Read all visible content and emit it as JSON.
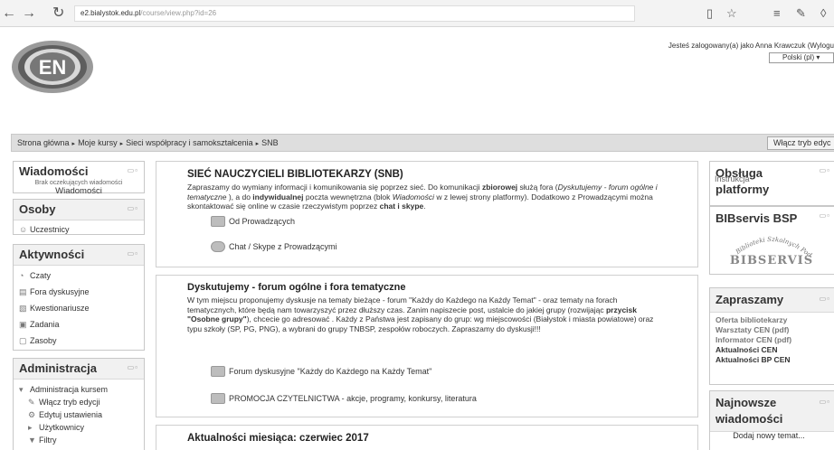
{
  "browser": {
    "url_host": "e2.bialystok.edu.pl",
    "url_path": "/course/view.php?id=26",
    "back_icon": "back-arrow-icon",
    "forward_icon": "forward-arrow-icon",
    "refresh_icon": "refresh-icon"
  },
  "header": {
    "login_info": "Jesteś zalogowany(a) jako Anna Krawczuk (Wylogu",
    "language": "Polski (pl)",
    "logo_letters": "EN"
  },
  "breadcrumb": {
    "items": [
      "Strona główna",
      "Moje kursy",
      "Sieci współpracy i samokształcenia",
      "SNB"
    ],
    "edit_toggle": "Włącz tryb edyc"
  },
  "left": {
    "messages": {
      "title": "Wiadomości",
      "empty": "Brak oczekujących wiadomości",
      "link": "Wiadomości"
    },
    "people": {
      "title": "Osoby",
      "participants": "Uczestnicy"
    },
    "activities": {
      "title": "Aktywności",
      "items": [
        "Czaty",
        "Fora dyskusyjne",
        "Kwestionariusze",
        "Zadania",
        "Zasoby"
      ]
    },
    "admin": {
      "title": "Administracja",
      "course_admin": "Administracja kursem",
      "items": [
        "Włącz tryb edycji",
        "Edytuj ustawienia",
        "Użytkownicy",
        "Filtry"
      ]
    }
  },
  "main": {
    "s1": {
      "title": "SIEĆ NAUCZYCIELI BIBLIOTEKARZY (SNB)",
      "text_parts": [
        "Zapraszamy do wymiany informacji i komunikowania się poprzez sieć. Do komunikacji ",
        "zbiorowej",
        " służą fora (",
        "Dyskutujemy - forum ogólne i tematyczne",
        " ), a do ",
        "indywidualnej",
        " poczta wewnętrzna (blok ",
        "Wiadomości",
        " w z lewej strony platformy). Dodatkowo z Prowadzącymi można skontaktować się online w czasie rzeczywistym poprzez ",
        "chat i skype",
        "."
      ],
      "link1": "Od Prowadzących",
      "link2": "Chat / Skype z Prowadzącymi"
    },
    "s2": {
      "title": "Dyskutujemy - forum ogólne i fora tematyczne",
      "text_a": "W tym miejscu proponujemy dyskusje na tematy bieżące - forum \"Każdy do Każdego na Każdy Temat\" - oraz tematy na forach tematycznych, które będą nam towarzyszyć przez dłuższy czas. Zanim napiszecie post, ustalcie do jakiej grupy (rozwijając ",
      "text_bold": "przycisk \"Osobne grupy\"",
      "text_b": "), chcecie go adresować . Każdy z Państwa jest zapisany do grup: wg miejscowości (Białystok i miasta powiatowe) oraz typu szkoły (SP, PG, PNG), a wybrani do grupy TNBSP, zespołów roboczych. Zapraszamy do dyskusji!!!",
      "link1": "Forum dyskusyjne \"Każdy do Każdego na Każdy Temat\"",
      "link2": "PROMOCJA CZYTELNICTWA - akcje, programy, konkursy, literatura"
    },
    "s3": {
      "title": "Aktualności miesiąca: czerwiec 2017"
    }
  },
  "right": {
    "support": {
      "title": "Obsługa platformy",
      "link": "Instrukcja"
    },
    "bibservis": {
      "title": "BIBservis BSP",
      "logo_text": "BIBSERVIS",
      "logo_arc": "Biblioteki Szkolnych Podlasia"
    },
    "invite": {
      "title": "Zapraszamy",
      "items": [
        "Oferta bibliotekarzy",
        "Warsztaty CEN (pdf)",
        "Informator CEN (pdf)",
        "Aktualności CEN",
        "Aktualności BP CEN"
      ]
    },
    "news": {
      "title": "Najnowsze wiadomości",
      "add": "Dodaj nowy temat..."
    }
  }
}
